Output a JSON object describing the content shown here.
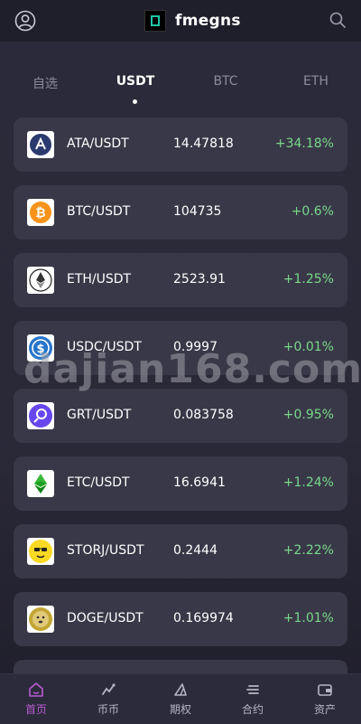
{
  "header": {
    "brand_name": "fmegns"
  },
  "tabs": [
    {
      "label": "自选",
      "active": false
    },
    {
      "label": "USDT",
      "active": true
    },
    {
      "label": "BTC",
      "active": false
    },
    {
      "label": "ETH",
      "active": false
    }
  ],
  "markets": [
    {
      "pair": "ATA/USDT",
      "price": "14.47818",
      "change": "+34.18%",
      "icon": "ata-logo-icon"
    },
    {
      "pair": "BTC/USDT",
      "price": "104735",
      "change": "+0.6%",
      "icon": "btc-logo-icon"
    },
    {
      "pair": "ETH/USDT",
      "price": "2523.91",
      "change": "+1.25%",
      "icon": "eth-logo-icon"
    },
    {
      "pair": "USDC/USDT",
      "price": "0.9997",
      "change": "+0.01%",
      "icon": "usdc-logo-icon"
    },
    {
      "pair": "GRT/USDT",
      "price": "0.083758",
      "change": "+0.95%",
      "icon": "grt-logo-icon"
    },
    {
      "pair": "ETC/USDT",
      "price": "16.6941",
      "change": "+1.24%",
      "icon": "etc-logo-icon"
    },
    {
      "pair": "STORJ/USDT",
      "price": "0.2444",
      "change": "+2.22%",
      "icon": "storj-logo-icon"
    },
    {
      "pair": "DOGE/USDT",
      "price": "0.169974",
      "change": "+1.01%",
      "icon": "doge-logo-icon"
    }
  ],
  "watermark": "dajian168.com",
  "bottom_nav": [
    {
      "label": "首页",
      "icon": "home-icon",
      "active": true
    },
    {
      "label": "币币",
      "icon": "trade-icon",
      "active": false
    },
    {
      "label": "期权",
      "icon": "options-icon",
      "active": false
    },
    {
      "label": "合约",
      "icon": "contract-icon",
      "active": false
    },
    {
      "label": "资产",
      "icon": "wallet-icon",
      "active": false
    }
  ],
  "colors": {
    "positive": "#79d98a",
    "accent": "#b85bd3",
    "background": "#2b2a3a",
    "card": "#393848"
  }
}
